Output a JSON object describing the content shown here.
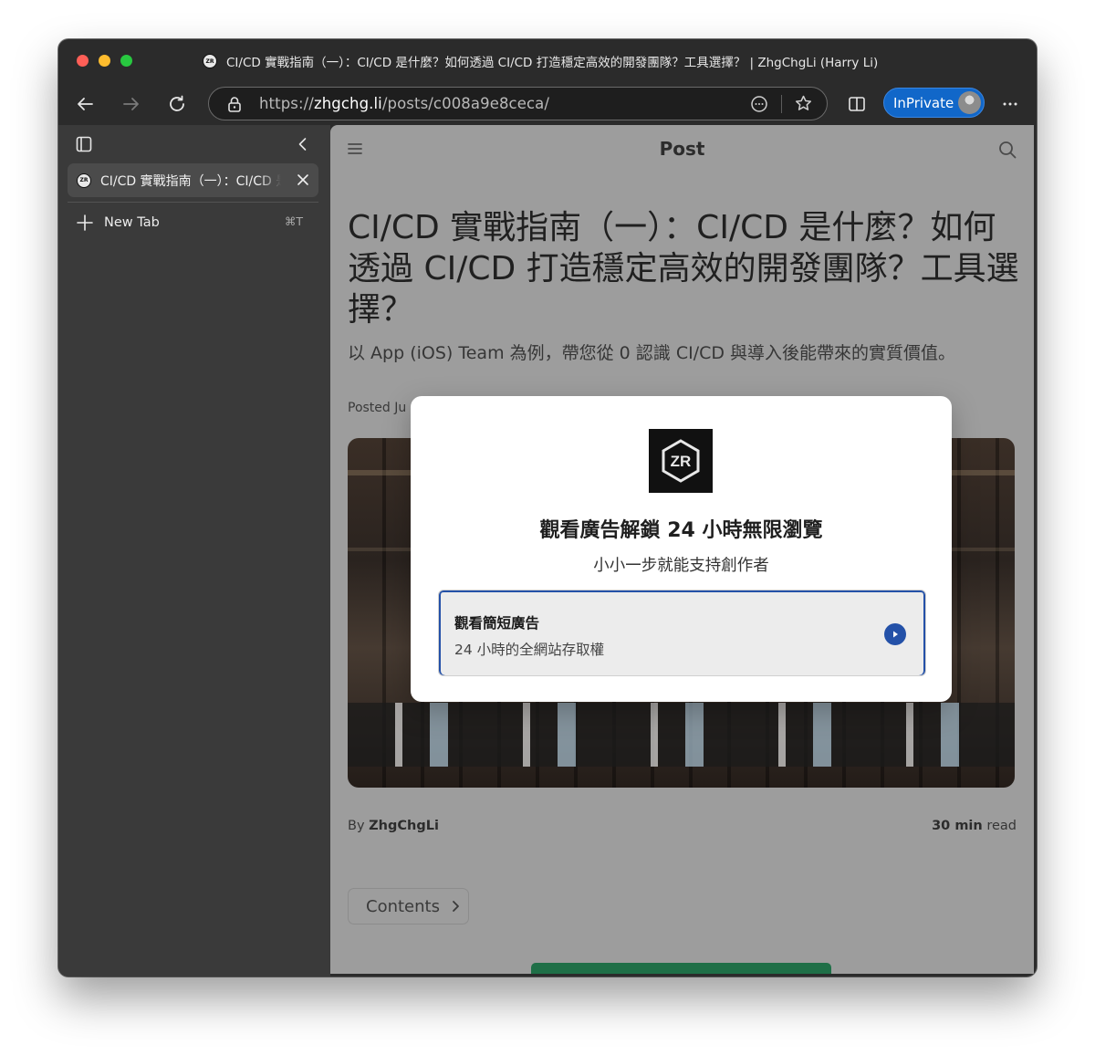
{
  "window": {
    "title": "CI/CD 實戰指南（一）：CI/CD 是什麼？如何透過 CI/CD 打造穩定高效的開發團隊？工具選擇？ | ZhgChgLi (Harry Li)",
    "favicon_icon": "zhgchgli-logo-icon"
  },
  "toolbar": {
    "url_scheme": "https://",
    "url_host": "zhgchg.li",
    "url_path": "/posts/c008a9e8ceca/",
    "inprivate_label": "InPrivate",
    "accent": "#1167c9"
  },
  "sidebar": {
    "tabs": [
      {
        "title": "CI/CD 實戰指南（一）：CI/CD 是什麼？如何透過 CI/CD 打造穩定高效的開發團隊？工具選擇？",
        "active": true
      }
    ],
    "new_tab_label": "New Tab",
    "new_tab_shortcut": "⌘T"
  },
  "page": {
    "header_title": "Post",
    "article_title": "CI/CD 實戰指南（一）：CI/CD 是什麼？如何透過 CI/CD 打造穩定高效的開發團隊？工具選擇？",
    "article_subtitle": "以 App (iOS) Team 為例，帶您從 0 認識 CI/CD 與導入後能帶來的實質價值。",
    "posted_prefix": "Posted Ju",
    "by_prefix": "By",
    "author": "ZhgChgLi",
    "read_time_value": "30 min",
    "read_time_suffix": "read",
    "contents_label": "Contents"
  },
  "modal": {
    "logo_icon": "zr-logo-icon",
    "heading": "觀看廣告解鎖 24 小時無限瀏覽",
    "subheading": "小小一步就能支持創作者",
    "option_title": "觀看簡短廣告",
    "option_description": "24 小時的全網站存取權",
    "option_icon": "play-icon",
    "accent": "#2451a8"
  }
}
